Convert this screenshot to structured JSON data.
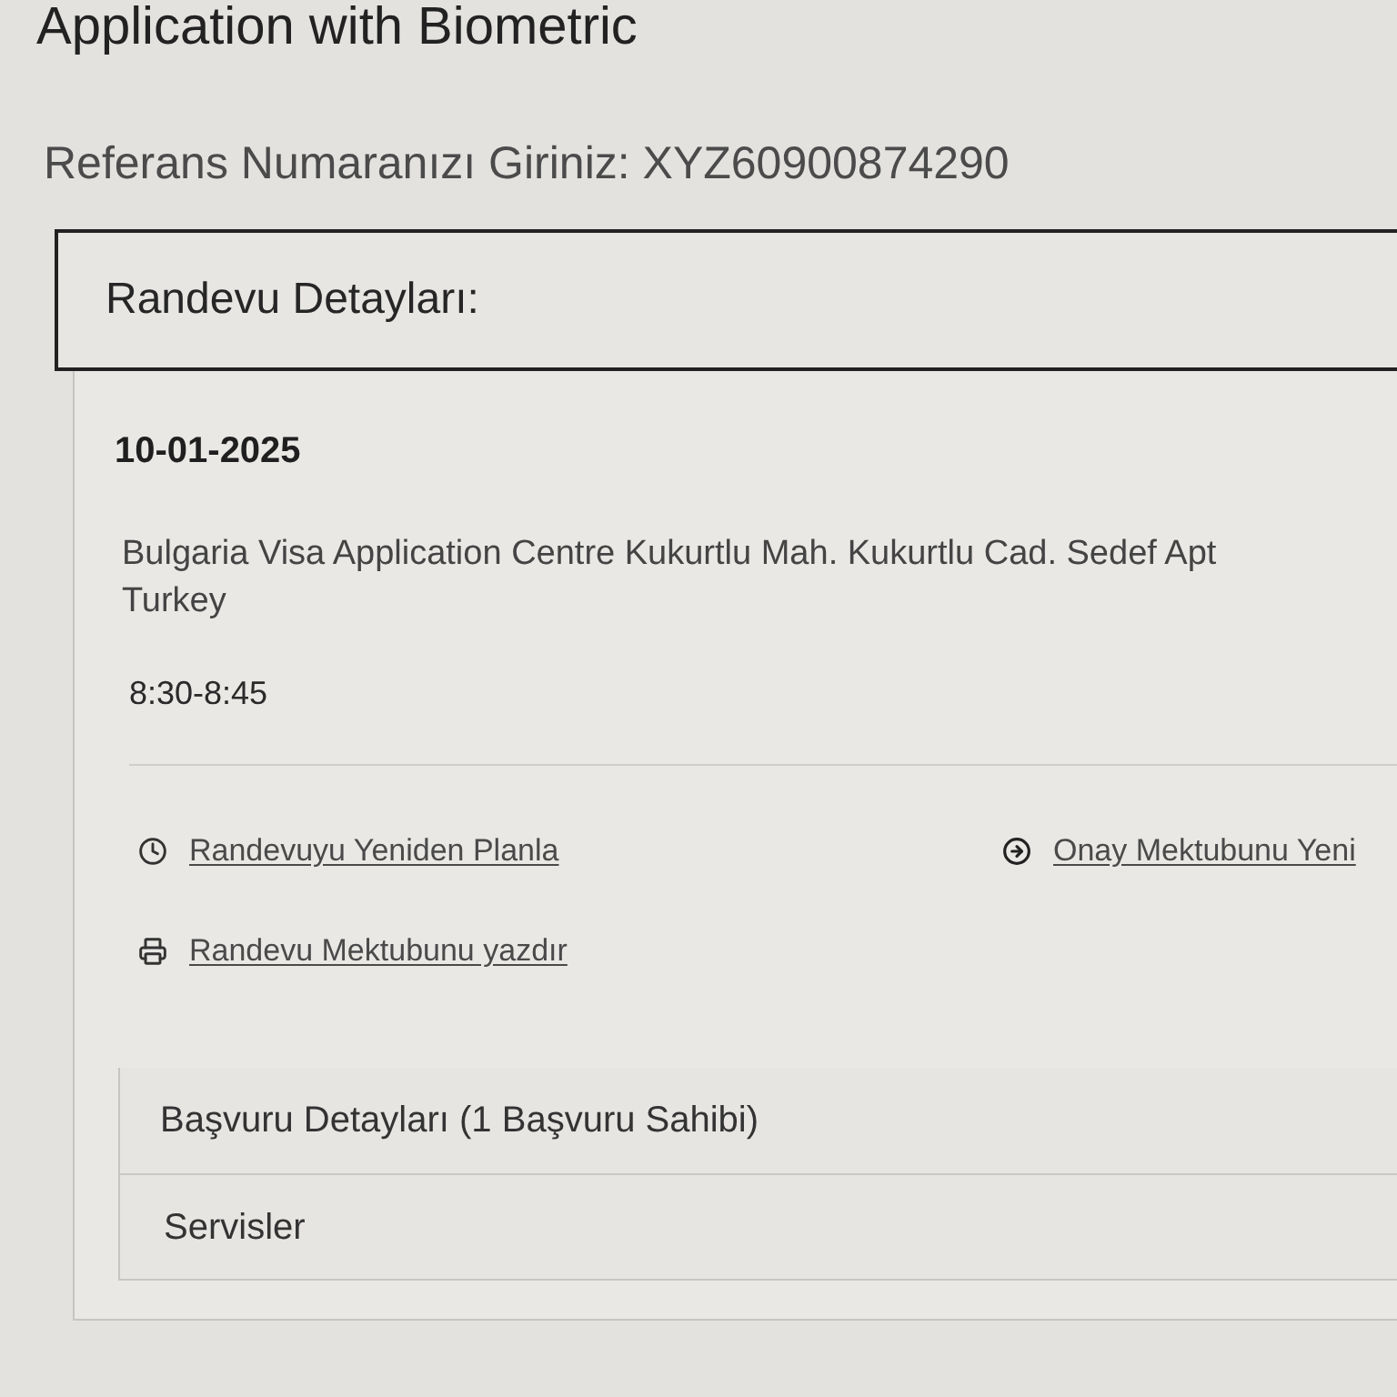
{
  "page": {
    "title": "Application with Biometric",
    "reference": "Referans Numaranızı Giriniz: XYZ60900874290"
  },
  "appointment": {
    "heading": "Randevu Detayları:",
    "date": "10-01-2025",
    "address_lines": [
      "Bulgaria Visa Application Centre Kukurtlu Mah. Kukurtlu Cad. Sedef Apt",
      "Turkey"
    ],
    "time": "8:30-8:45",
    "actions": [
      {
        "kind": "reschedule",
        "label": "Randevuyu Yeniden Planla"
      },
      {
        "kind": "confirm",
        "label": "Onay Mektubunu Yeni"
      },
      {
        "kind": "print",
        "label": "Randevu Mektubunu yazdır"
      }
    ]
  },
  "sections": [
    {
      "label": "Başvuru Detayları (1 Başvuru Sahibi)"
    },
    {
      "label": "Servisler"
    }
  ]
}
